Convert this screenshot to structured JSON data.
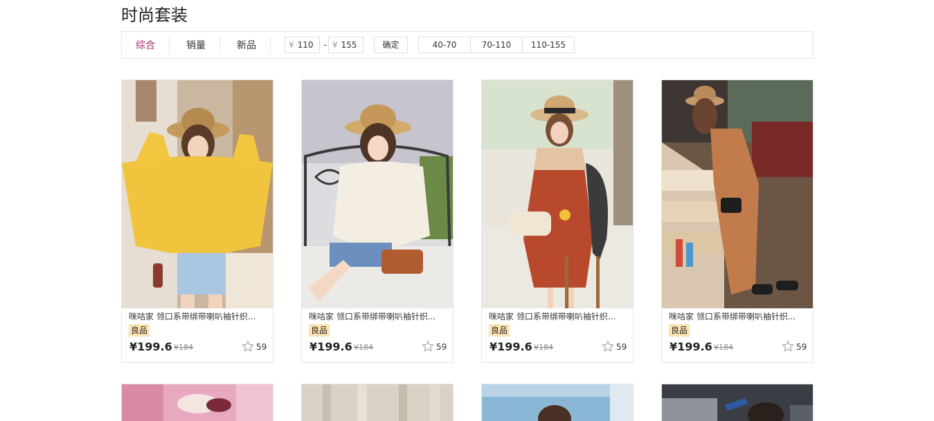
{
  "page": {
    "title": "时尚套装"
  },
  "filter": {
    "sort_tabs": [
      "综合",
      "销量",
      "新品"
    ],
    "currency_symbol": "¥",
    "price_min": "110",
    "price_max": "155",
    "dash": "-",
    "confirm_label": "确定",
    "ranges": [
      "40-70",
      "70-110",
      "110-155"
    ],
    "active_color": "#a5286e"
  },
  "products": [
    {
      "name": "咪咕家 领口系带绑带喇叭袖针织...",
      "badge": "良品",
      "price": "¥199.6",
      "original_price": "¥184",
      "likes": "59"
    },
    {
      "name": "咪咕家 领口系带绑带喇叭袖针织...",
      "badge": "良品",
      "price": "¥199.6",
      "original_price": "¥184",
      "likes": "59"
    },
    {
      "name": "咪咕家 领口系带绑带喇叭袖针织...",
      "badge": "良品",
      "price": "¥199.6",
      "original_price": "¥184",
      "likes": "59"
    },
    {
      "name": "咪咕家 领口系带绑带喇叭袖针织...",
      "badge": "良品",
      "price": "¥199.6",
      "original_price": "¥184",
      "likes": "59"
    }
  ],
  "icons": {
    "like": "star-outline-icon"
  },
  "colors": {
    "badge_bg": "#fde3b2",
    "border": "#e5e5e5"
  }
}
